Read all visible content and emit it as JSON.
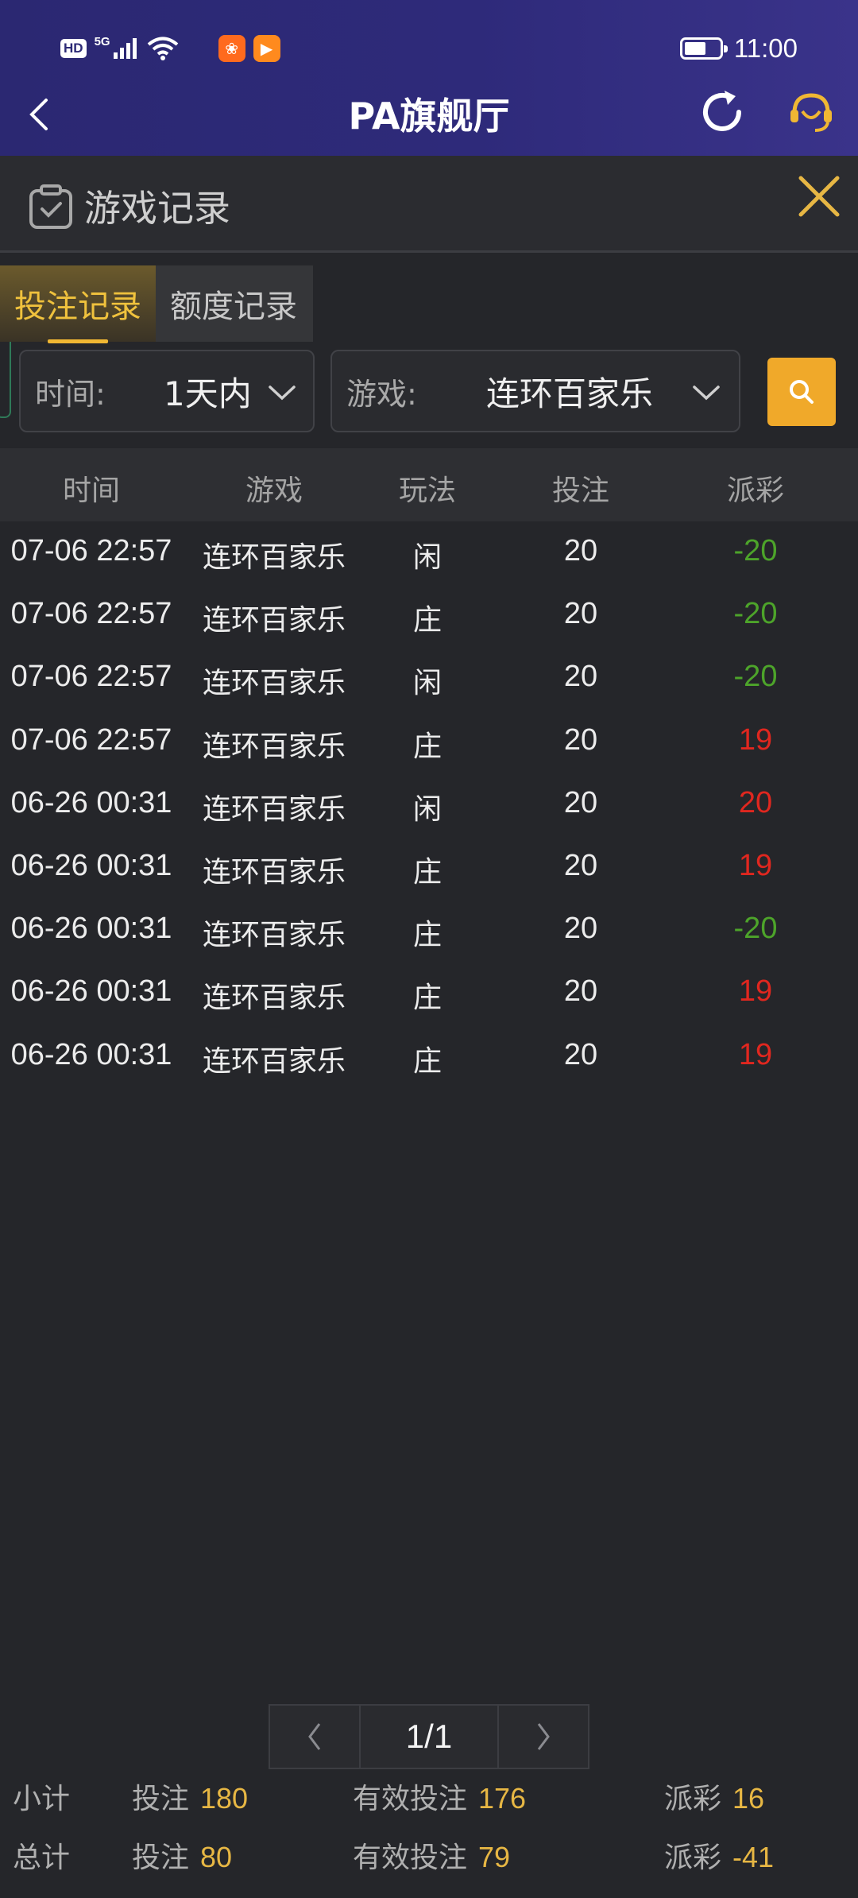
{
  "status_bar": {
    "left_badges": [
      "HD",
      "5G"
    ],
    "time": "11:00",
    "battery_level": 0.6,
    "icons": [
      "signal-icon",
      "wifi-icon",
      "app-notification-icon",
      "video-app-icon",
      "battery-icon"
    ]
  },
  "header": {
    "title": "PA旗舰厅",
    "icons": [
      "back-icon",
      "refresh-icon",
      "customer-service-icon"
    ]
  },
  "panel": {
    "title": "游戏记录",
    "icons": [
      "record-clipboard-icon",
      "close-icon"
    ]
  },
  "tabs": [
    {
      "label": "投注记录",
      "active": true
    },
    {
      "label": "额度记录",
      "active": false
    }
  ],
  "filters": {
    "time_label": "时间:",
    "time_value": "1天内",
    "game_label": "游戏:",
    "game_value": "连环百家乐",
    "search_icon": "search-icon"
  },
  "table": {
    "headers": [
      "时间",
      "游戏",
      "玩法",
      "投注",
      "派彩"
    ],
    "rows": [
      {
        "time": "07-06 22:57",
        "game": "连环百家乐",
        "play": "闲",
        "bet": "20",
        "payout": "-20"
      },
      {
        "time": "07-06 22:57",
        "game": "连环百家乐",
        "play": "庄",
        "bet": "20",
        "payout": "-20"
      },
      {
        "time": "07-06 22:57",
        "game": "连环百家乐",
        "play": "闲",
        "bet": "20",
        "payout": "-20"
      },
      {
        "time": "07-06 22:57",
        "game": "连环百家乐",
        "play": "庄",
        "bet": "20",
        "payout": "19"
      },
      {
        "time": "06-26 00:31",
        "game": "连环百家乐",
        "play": "闲",
        "bet": "20",
        "payout": "20"
      },
      {
        "time": "06-26 00:31",
        "game": "连环百家乐",
        "play": "庄",
        "bet": "20",
        "payout": "19"
      },
      {
        "time": "06-26 00:31",
        "game": "连环百家乐",
        "play": "庄",
        "bet": "20",
        "payout": "-20"
      },
      {
        "time": "06-26 00:31",
        "game": "连环百家乐",
        "play": "庄",
        "bet": "20",
        "payout": "19"
      },
      {
        "time": "06-26 00:31",
        "game": "连环百家乐",
        "play": "庄",
        "bet": "20",
        "payout": "19"
      }
    ],
    "colors": {
      "positive": "#e0271f",
      "negative": "#4da42a"
    }
  },
  "pagination": {
    "page": "1/1",
    "prev_icon": "chevron-left-icon",
    "next_icon": "chevron-right-icon"
  },
  "summary": {
    "subtotal": {
      "label": "小计",
      "bet_label": "投注",
      "bet": "180",
      "valid_label": "有效投注",
      "valid": "176",
      "payout_label": "派彩",
      "payout": "16"
    },
    "total": {
      "label": "总计",
      "bet_label": "投注",
      "bet": "80",
      "valid_label": "有效投注",
      "valid": "79",
      "payout_label": "派彩",
      "payout": "-41"
    }
  },
  "colors": {
    "header_bg": "#2e2a7a",
    "accent_gold": "#f0b733",
    "background": "#25262a"
  }
}
